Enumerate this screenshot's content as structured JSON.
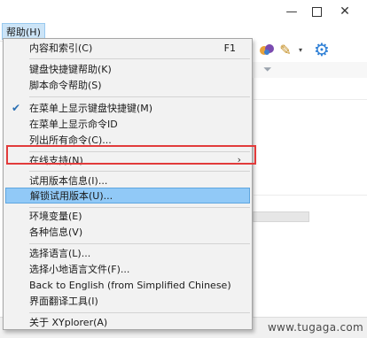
{
  "menubar": {
    "help_label": "帮助(H)"
  },
  "watermark": "www.tugaga.com",
  "help_menu": {
    "items": [
      {
        "label": "内容和索引(C)",
        "shortcut": "F1"
      },
      {
        "label": "键盘快捷键帮助(K)"
      },
      {
        "label": "脚本命令帮助(S)"
      },
      {
        "label": "在菜单上显示键盘快捷键(M)",
        "checked": true
      },
      {
        "label": "在菜单上显示命令ID"
      },
      {
        "label": "列出所有命令(C)..."
      },
      {
        "label": "在线支持(N)",
        "submenu": true
      },
      {
        "label": "试用版本信息(I)..."
      },
      {
        "label": "解锁试用版本(U)...",
        "highlighted": true
      },
      {
        "label": "环境变量(E)"
      },
      {
        "label": "各种信息(V)"
      },
      {
        "label": "选择语言(L)..."
      },
      {
        "label": "选择小地语言文件(F)..."
      },
      {
        "label": "Back to English (from Simplified Chinese)"
      },
      {
        "label": "界面翻译工具(I)"
      },
      {
        "label": "关于 XYplorer(A)"
      }
    ]
  },
  "icons": {
    "check": "check-icon",
    "submenu": "chevron-right-icon",
    "settings": "gear-icon",
    "filter": "filter-icon"
  },
  "colors": {
    "highlight": "#91c9f7",
    "annotation_box": "#e23b3b",
    "menu_bg": "#f2f2f2"
  }
}
